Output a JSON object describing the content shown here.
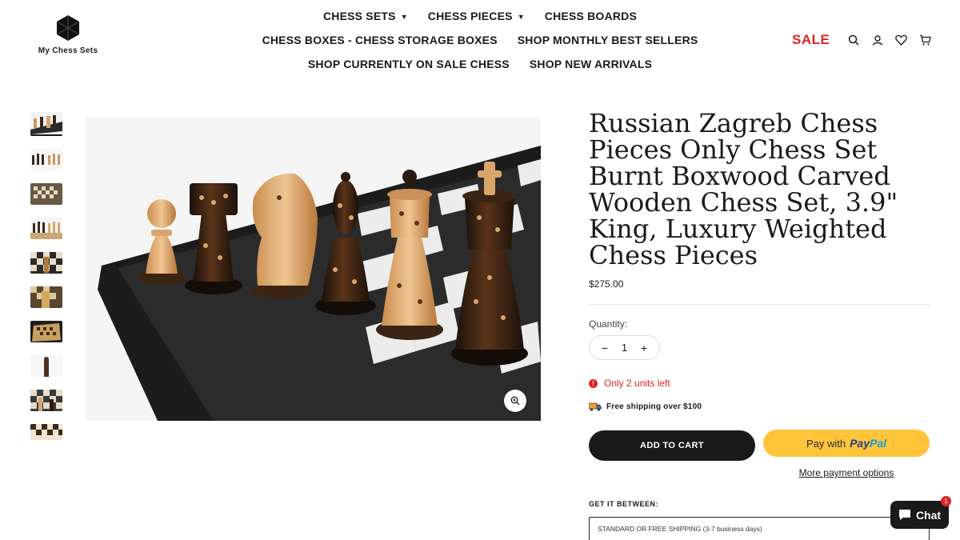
{
  "brand": {
    "name": "My Chess Sets",
    "logo_icon": "hexagon-logo-icon"
  },
  "nav": {
    "row1": [
      {
        "label": "CHESS SETS",
        "dropdown": true
      },
      {
        "label": "CHESS PIECES",
        "dropdown": true
      },
      {
        "label": "CHESS BOARDS",
        "dropdown": false
      }
    ],
    "row2": [
      {
        "label": "CHESS BOXES - CHESS STORAGE BOXES"
      },
      {
        "label": "SHOP MONTHLY BEST SELLERS"
      }
    ],
    "row3": [
      {
        "label": "SHOP CURRENTLY ON SALE CHESS"
      },
      {
        "label": "SHOP NEW ARRIVALS"
      }
    ]
  },
  "header": {
    "sale_label": "SALE",
    "icons": [
      "search-icon",
      "account-icon",
      "wishlist-icon",
      "cart-icon"
    ]
  },
  "gallery": {
    "thumbnail_count": 10,
    "active_thumbnail": 1,
    "zoom_icon": "zoom-in-icon"
  },
  "product": {
    "title": "Russian Zagreb Chess Pieces Only Chess Set Burnt Boxwood Carved Wooden Chess Set, 3.9\" King, Luxury Weighted Chess Pieces",
    "price": "$275.00",
    "quantity_label": "Quantity:",
    "quantity_value": "1",
    "qty_minus": "−",
    "qty_plus": "+",
    "stock_text": "Only 2 units left",
    "shipping_note": "Free shipping over $100",
    "add_to_cart": "ADD TO CART",
    "paypal_prefix": "Pay with",
    "paypal_brand_a": "Pay",
    "paypal_brand_b": "Pal",
    "more_payment": "More payment options",
    "delivery_label": "GET IT BETWEEN:",
    "shipping_option": "STANDARD OR FREE SHIPPING (3-7 business days)"
  },
  "chat": {
    "label": "Chat",
    "badge": "1"
  },
  "colors": {
    "accent_red": "#e02424",
    "dark": "#1a1a1a",
    "paypal_yellow": "#ffc439"
  }
}
